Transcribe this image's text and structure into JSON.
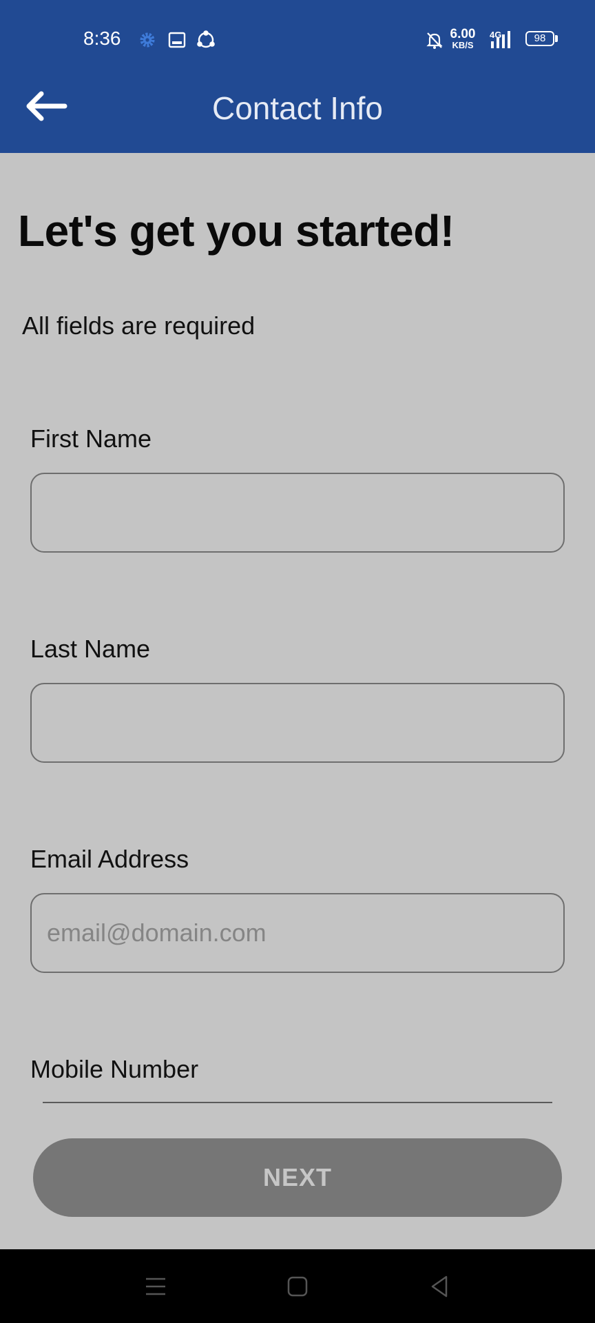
{
  "status_bar": {
    "time": "8:36",
    "net_speed_value": "6.00",
    "net_speed_unit": "KB/S",
    "network_type": "4G",
    "battery": "98"
  },
  "app_bar": {
    "title": "Contact Info"
  },
  "form": {
    "headline": "Let's get you started!",
    "subtitle": "All fields are required",
    "first_name": {
      "label": "First Name",
      "value": ""
    },
    "last_name": {
      "label": "Last Name",
      "value": ""
    },
    "email": {
      "label": "Email Address",
      "value": "",
      "placeholder": "email@domain.com"
    },
    "mobile": {
      "label": "Mobile Number"
    },
    "next_label": "NEXT"
  },
  "colors": {
    "app_bar": "#214a93",
    "background": "#c4c4c4",
    "settings_icon": "#3e7bd9",
    "button_disabled": "#767676"
  },
  "icons": {
    "back": "arrow-left",
    "status_left": [
      "gear",
      "image",
      "share"
    ],
    "status_right": [
      "bell-off",
      "signal",
      "battery"
    ],
    "nav": [
      "menu",
      "home",
      "back"
    ]
  }
}
